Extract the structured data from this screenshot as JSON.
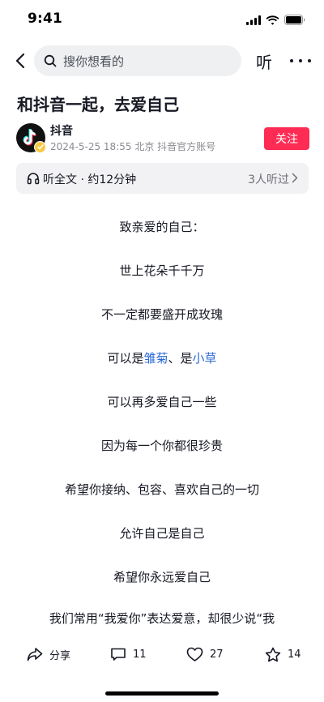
{
  "status_bar": {
    "time": "9:41"
  },
  "nav": {
    "search_placeholder": "搜你想看的",
    "listen_label": "听"
  },
  "article": {
    "title": "和抖音一起，去爱自己",
    "author": {
      "name": "抖音",
      "meta": "2024-5-25  18:55  北京  抖音官方账号",
      "follow_label": "关注"
    },
    "listen_bar": {
      "label": "听全文 · 约12分钟",
      "count": "3人听过"
    },
    "paragraphs": {
      "p1": "致亲爱的自己：",
      "p2": "世上花朵千千万",
      "p3": "不一定都要盛开成玫瑰",
      "p4_prefix": "可以是",
      "p4_link1": "雏菊",
      "p4_mid": "、是",
      "p4_link2": "小草",
      "p5": "可以再多爱自己一些",
      "p6": "因为每一个你都很珍贵",
      "p7": "希望你接纳、包容、喜欢自己的一切",
      "p8": "允许自己是自己",
      "p9": "希望你永远爱自己",
      "p10": "我们常用“我爱你”表达爱意，却很少说“我"
    }
  },
  "actions": {
    "share_label": "分享",
    "comment_count": "11",
    "like_count": "27",
    "favorite_count": "14"
  },
  "colors": {
    "accent": "#fe2c55",
    "link": "#2f6bd8",
    "text": "#161823",
    "muted": "#8a8b91"
  },
  "icons": [
    "signal-icon",
    "wifi-icon",
    "battery-icon",
    "back-arrow-icon",
    "search-icon",
    "more-icon",
    "douyin-logo-icon",
    "verified-icon",
    "headphone-icon",
    "chevron-right-icon",
    "share-icon",
    "comment-icon",
    "heart-icon",
    "star-icon"
  ]
}
